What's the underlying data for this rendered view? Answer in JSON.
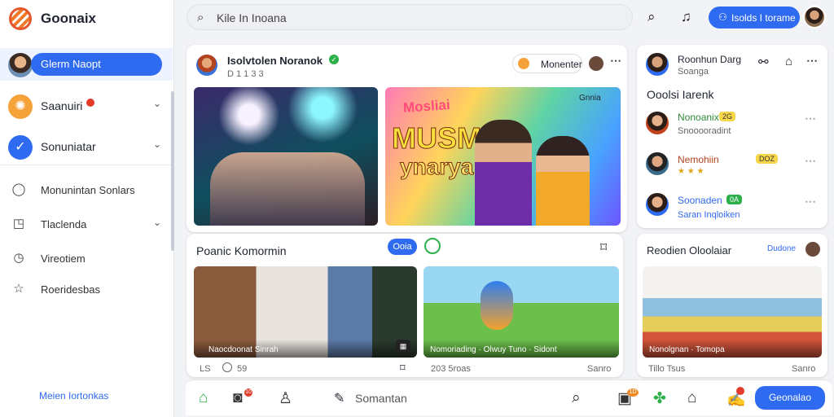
{
  "app": {
    "logo_text": "Goonaix"
  },
  "sidebar": {
    "user_pill": "Glerm Naopt",
    "items": [
      {
        "label": "Saanuiri",
        "icon": "sun-icon",
        "has_badge": true
      },
      {
        "label": "Sonuniatar",
        "icon": "check-circle-icon"
      }
    ],
    "sub_items": [
      {
        "label": "Monunintan Sonlars",
        "icon": "chat-bubble-icon"
      },
      {
        "label": "Tlaclenda",
        "icon": "calendar-icon"
      },
      {
        "label": "Vireotiem",
        "icon": "clock-icon"
      },
      {
        "label": "Roeridesbas",
        "icon": "star-icon"
      }
    ],
    "footer": "Meien Iortonkas"
  },
  "topbar": {
    "search_placeholder": "Kile In Inoana",
    "cta_label": "Isolds I torame"
  },
  "main_post": {
    "author": "Isolvtolen Noranok",
    "meta": "D 1 1 3 3",
    "action_label": "Monenter",
    "photo2_text_top": "Mosliai",
    "photo2_text_big": "MUSMIA",
    "photo2_text_sub": "ynarya",
    "photo2_tag": "Gnnia"
  },
  "second_post": {
    "title": "Poanic Komormin",
    "button_label": "Ooia",
    "cap1": "Naocdoonat Sinrah",
    "cap2_a": "Nomoriading",
    "cap2_b": "Olwuy Tuno",
    "cap2_c": "Sidont",
    "foot_left": "LS",
    "foot_left_count": "59",
    "foot_mid": "203 5roas",
    "foot_right": "Sanro"
  },
  "right_panel": {
    "user_name": "Roonhun Darg",
    "user_sub": "Soanga",
    "section_title": "Ooolsi Iarenk",
    "people": [
      {
        "name": "Nonoanix",
        "badge": "2G",
        "sub": "Snooooradint"
      },
      {
        "name": "Nemohiin",
        "badge": "DOZ",
        "sub": ""
      },
      {
        "name": "Soonaden",
        "badge": "0A",
        "sub": "Saran Inqloiken"
      }
    ]
  },
  "right_panel2": {
    "title": "Reodien Oloolaiar",
    "tag": "Dudone",
    "caption_a": "Nonolgnan",
    "caption_b": "Tomopa",
    "foot_left": "Tillo Tsus",
    "foot_right": "Sanro"
  },
  "bottombar": {
    "compose_placeholder": "Somantan",
    "cta_label": "Geonalao",
    "badge_a": "10",
    "badge_b": "1D"
  },
  "colors": {
    "accent": "#2f6bf0",
    "notify": "#e23b2a",
    "verified": "#2db04a"
  }
}
